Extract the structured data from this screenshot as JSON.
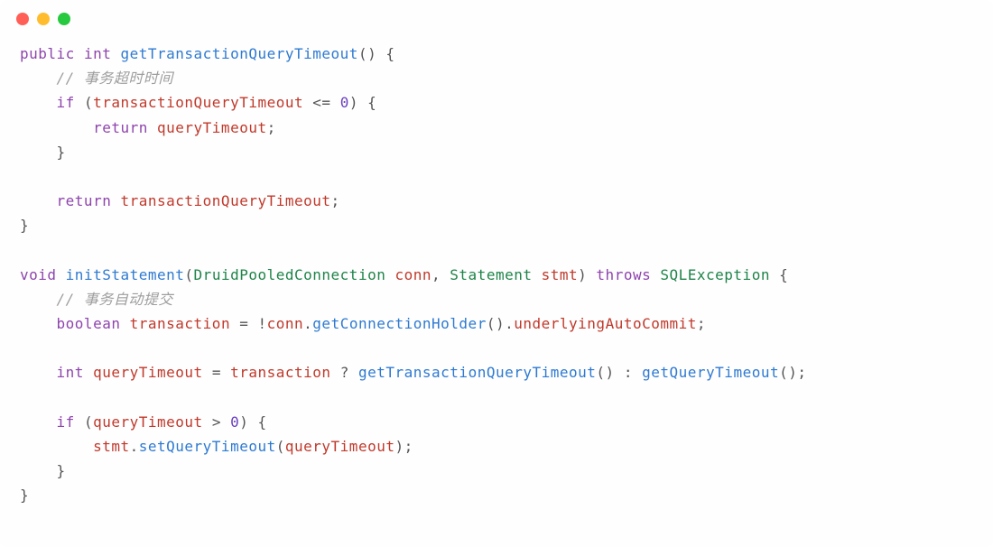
{
  "titlebar": {
    "close": "red",
    "minimize": "yellow",
    "zoom": "green"
  },
  "code": {
    "m1": {
      "mod": "public",
      "ret": "int",
      "name": "getTransactionQueryTimeout",
      "cmt": "// 事务超时时间",
      "kw_if": "if",
      "cond_var": "transactionQueryTimeout",
      "cond_op": "<=",
      "cond_val": "0",
      "ret1_kw": "return",
      "ret1_var": "queryTimeout",
      "ret2_kw": "return",
      "ret2_var": "transactionQueryTimeout"
    },
    "m2": {
      "ret": "void",
      "name": "initStatement",
      "p1_type": "DruidPooledConnection",
      "p1_name": "conn",
      "p2_type": "Statement",
      "p2_name": "stmt",
      "throws_kw": "throws",
      "throws_type": "SQLException",
      "cmt": "// 事务自动提交",
      "l1_type": "boolean",
      "l1_var": "transaction",
      "l1_rhs_conn": "conn",
      "l1_rhs_m1": "getConnectionHolder",
      "l1_rhs_m2": "underlyingAutoCommit",
      "l2_type": "int",
      "l2_var": "queryTimeout",
      "l2_cond": "transaction",
      "l2_t": "getTransactionQueryTimeout",
      "l2_f": "getQueryTimeout",
      "if_kw": "if",
      "if_var": "queryTimeout",
      "if_op": ">",
      "if_val": "0",
      "body_obj": "stmt",
      "body_m": "setQueryTimeout",
      "body_arg": "queryTimeout"
    }
  }
}
